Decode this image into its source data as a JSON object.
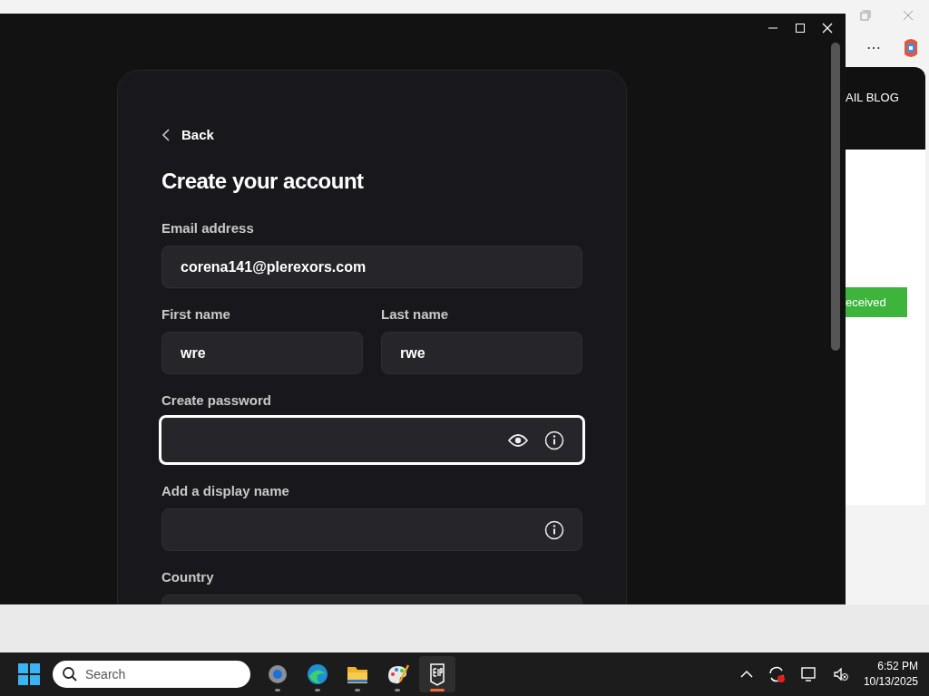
{
  "browser_behind": {
    "menu": "⋯",
    "header_text": "AIL BLOG",
    "button": "eceived"
  },
  "dialog": {
    "back": "Back",
    "title": "Create your account",
    "rows": [
      [
        {
          "label": "Email address",
          "value": "corena141@plerexors.com",
          "focused": false
        }
      ],
      [
        {
          "label": "First name",
          "value": "wre",
          "focused": false
        },
        {
          "label": "Last name",
          "value": "rwe",
          "focused": false
        }
      ],
      [
        {
          "label": "Create password",
          "focused": true,
          "icons": [
            {
              "kind": "reveal"
            },
            {
              "kind": "info"
            }
          ]
        }
      ],
      [
        {
          "label": "Add a display name",
          "focused": false,
          "icons": [
            {
              "kind": "info"
            }
          ]
        }
      ],
      [
        {
          "label": "Country",
          "focused": false
        }
      ]
    ]
  },
  "taskbar": {
    "search_placeholder": "Search",
    "apps": [
      {
        "kind": "settings",
        "active": false
      },
      {
        "kind": "edge",
        "active": false
      },
      {
        "kind": "folder",
        "active": false
      },
      {
        "kind": "paint",
        "active": false
      },
      {
        "kind": "epic",
        "active": true
      }
    ],
    "time": "6:52 PM",
    "date": "10/13/2025"
  }
}
